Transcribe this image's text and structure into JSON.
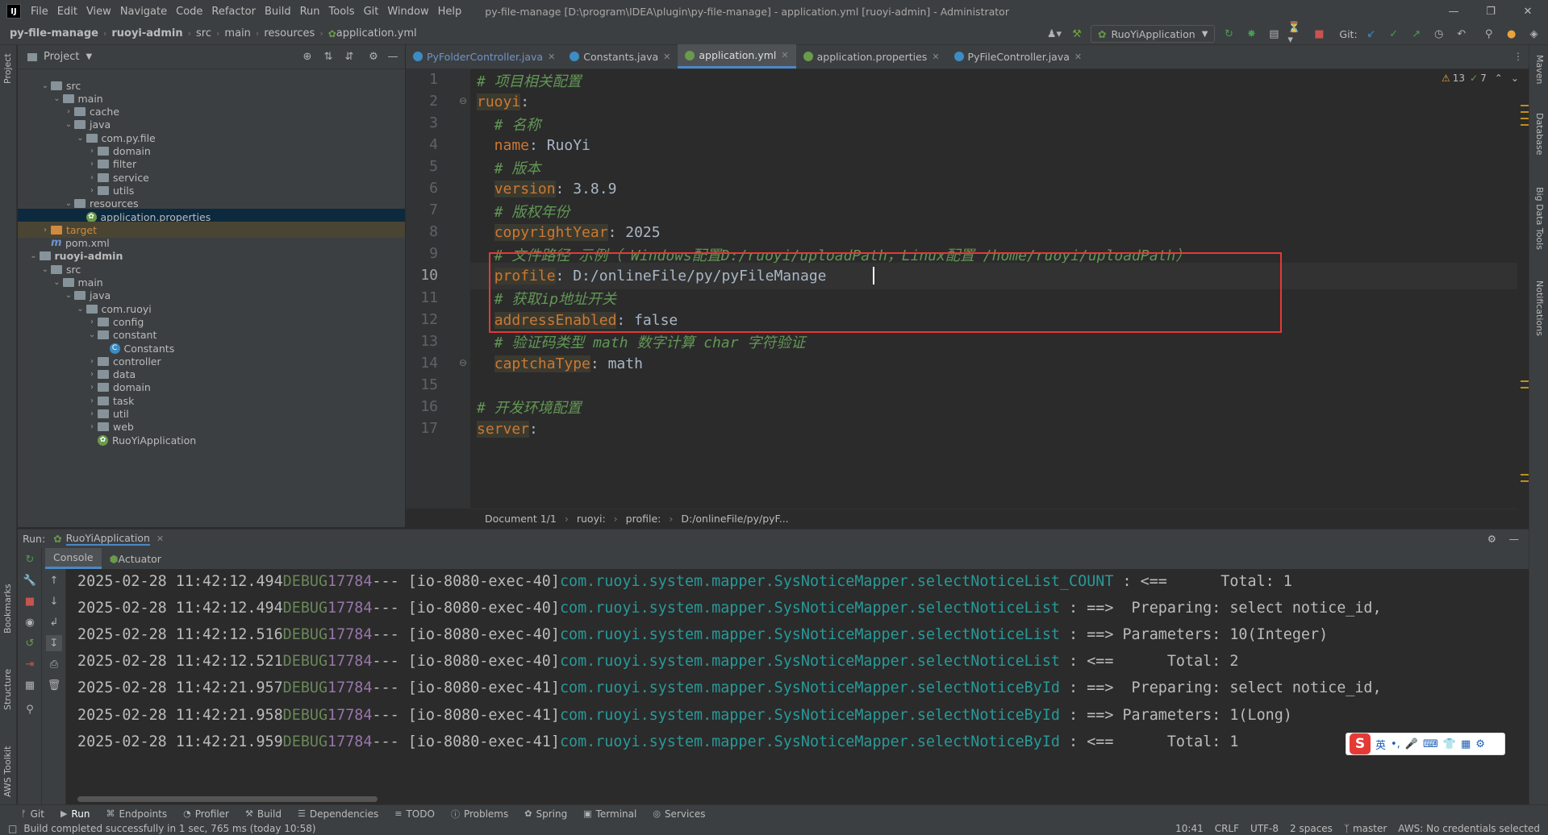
{
  "window": {
    "title": "py-file-manage [D:\\program\\IDEA\\plugin\\py-file-manage] - application.yml [ruoyi-admin] - Administrator",
    "menu": [
      "File",
      "Edit",
      "View",
      "Navigate",
      "Code",
      "Refactor",
      "Build",
      "Run",
      "Tools",
      "Git",
      "Window",
      "Help"
    ]
  },
  "breadcrumb": [
    "py-file-manage",
    "ruoyi-admin",
    "src",
    "main",
    "resources",
    "application.yml"
  ],
  "toolbar": {
    "run_config": "RuoYiApplication",
    "git_label": "Git:"
  },
  "left_stripe": {
    "project": "Project",
    "bookmarks": "Bookmarks",
    "structure": "Structure",
    "aws": "AWS Toolkit"
  },
  "right_stripe": {
    "maven": "Maven",
    "database": "Database",
    "bigdata": "Big Data Tools",
    "notifications": "Notifications"
  },
  "project_panel": {
    "header": "Project",
    "tree": [
      {
        "label": "src",
        "depth": 2,
        "type": "folder",
        "arrow": "open"
      },
      {
        "label": "main",
        "depth": 3,
        "type": "folder",
        "arrow": "open"
      },
      {
        "label": "cache",
        "depth": 4,
        "type": "folder",
        "arrow": "closed"
      },
      {
        "label": "java",
        "depth": 4,
        "type": "folder",
        "arrow": "open"
      },
      {
        "label": "com.py.file",
        "depth": 5,
        "type": "folder",
        "arrow": "open"
      },
      {
        "label": "domain",
        "depth": 6,
        "type": "folder",
        "arrow": "closed"
      },
      {
        "label": "filter",
        "depth": 6,
        "type": "folder",
        "arrow": "closed"
      },
      {
        "label": "service",
        "depth": 6,
        "type": "folder",
        "arrow": "closed"
      },
      {
        "label": "utils",
        "depth": 6,
        "type": "folder",
        "arrow": "closed"
      },
      {
        "label": "resources",
        "depth": 4,
        "type": "folder",
        "arrow": "open"
      },
      {
        "label": "application.properties",
        "depth": 5,
        "type": "leaf",
        "arrow": "",
        "selected": true
      },
      {
        "label": "target",
        "depth": 2,
        "type": "orange",
        "arrow": "closed"
      },
      {
        "label": "pom.xml",
        "depth": 2,
        "type": "m",
        "arrow": ""
      },
      {
        "label": "ruoyi-admin",
        "depth": 1,
        "type": "folder",
        "arrow": "open",
        "bold": true
      },
      {
        "label": "src",
        "depth": 2,
        "type": "folder",
        "arrow": "open"
      },
      {
        "label": "main",
        "depth": 3,
        "type": "folder",
        "arrow": "open"
      },
      {
        "label": "java",
        "depth": 4,
        "type": "folder",
        "arrow": "open"
      },
      {
        "label": "com.ruoyi",
        "depth": 5,
        "type": "folder",
        "arrow": "open"
      },
      {
        "label": "config",
        "depth": 6,
        "type": "folder",
        "arrow": "closed"
      },
      {
        "label": "constant",
        "depth": 6,
        "type": "folder",
        "arrow": "open"
      },
      {
        "label": "Constants",
        "depth": 7,
        "type": "cls",
        "arrow": ""
      },
      {
        "label": "controller",
        "depth": 6,
        "type": "folder",
        "arrow": "closed"
      },
      {
        "label": "data",
        "depth": 6,
        "type": "folder",
        "arrow": "closed"
      },
      {
        "label": "domain",
        "depth": 6,
        "type": "folder",
        "arrow": "closed"
      },
      {
        "label": "task",
        "depth": 6,
        "type": "folder",
        "arrow": "closed"
      },
      {
        "label": "util",
        "depth": 6,
        "type": "folder",
        "arrow": "closed"
      },
      {
        "label": "web",
        "depth": 6,
        "type": "folder",
        "arrow": "closed"
      },
      {
        "label": "RuoYiApplication",
        "depth": 6,
        "type": "leaf",
        "arrow": ""
      }
    ]
  },
  "editor": {
    "tabs": [
      {
        "label": "PyFolderController.java",
        "icon": "class-icon",
        "active": false
      },
      {
        "label": "Constants.java",
        "icon": "class-icon",
        "active": false
      },
      {
        "label": "application.yml",
        "icon": "spring-leaf-icon",
        "active": true
      },
      {
        "label": "application.properties",
        "icon": "spring-leaf-icon",
        "active": false
      },
      {
        "label": "PyFileController.java",
        "icon": "class-icon",
        "active": false
      }
    ],
    "inspections": {
      "warnings": "13",
      "weak": "7"
    },
    "lines": [
      {
        "n": "1",
        "segs": [
          {
            "t": "# 项目相关配置",
            "c": "cm"
          }
        ]
      },
      {
        "n": "2",
        "segs": [
          {
            "t": "ruoyi",
            "c": "key"
          },
          {
            "t": ":",
            "c": "val"
          }
        ]
      },
      {
        "n": "3",
        "segs": [
          {
            "t": "  # 名称",
            "c": "cm"
          }
        ]
      },
      {
        "n": "4",
        "segs": [
          {
            "t": "  name",
            "c": "keyp"
          },
          {
            "t": ": RuoYi",
            "c": "val"
          }
        ]
      },
      {
        "n": "5",
        "segs": [
          {
            "t": "  # 版本",
            "c": "cm"
          }
        ]
      },
      {
        "n": "6",
        "segs": [
          {
            "t": "  ",
            "c": "val"
          },
          {
            "t": "version",
            "c": "key"
          },
          {
            "t": ": 3.8.9",
            "c": "val"
          }
        ]
      },
      {
        "n": "7",
        "segs": [
          {
            "t": "  # 版权年份",
            "c": "cm"
          }
        ]
      },
      {
        "n": "8",
        "segs": [
          {
            "t": "  ",
            "c": "val"
          },
          {
            "t": "copyrightYear",
            "c": "key"
          },
          {
            "t": ": 2025",
            "c": "val"
          }
        ]
      },
      {
        "n": "9",
        "segs": [
          {
            "t": "  # 文件路径 示例（ Windows配置D:/ruoyi/uploadPath，Linux配置 /home/ruoyi/uploadPath）",
            "c": "cm"
          }
        ]
      },
      {
        "n": "10",
        "segs": [
          {
            "t": "  ",
            "c": "val"
          },
          {
            "t": "profile",
            "c": "key"
          },
          {
            "t": ": D:/onlineFile/py/pyFileManage",
            "c": "val"
          }
        ],
        "current": true
      },
      {
        "n": "11",
        "segs": [
          {
            "t": "  # 获取ip地址开关",
            "c": "cm"
          }
        ]
      },
      {
        "n": "12",
        "segs": [
          {
            "t": "  ",
            "c": "val"
          },
          {
            "t": "addressEnabled",
            "c": "key"
          },
          {
            "t": ": false",
            "c": "val"
          }
        ]
      },
      {
        "n": "13",
        "segs": [
          {
            "t": "  # 验证码类型 math 数字计算 char 字符验证",
            "c": "cm"
          }
        ]
      },
      {
        "n": "14",
        "segs": [
          {
            "t": "  ",
            "c": "val"
          },
          {
            "t": "captchaType",
            "c": "key"
          },
          {
            "t": ": math",
            "c": "val"
          }
        ]
      },
      {
        "n": "15",
        "segs": []
      },
      {
        "n": "16",
        "segs": [
          {
            "t": "# 开发环境配置",
            "c": "cm"
          }
        ]
      },
      {
        "n": "17",
        "segs": [
          {
            "t": "server",
            "c": "key"
          },
          {
            "t": ":",
            "c": "val"
          }
        ]
      }
    ],
    "crumbs": [
      "Document 1/1",
      "ruoyi:",
      "profile:",
      "D:/onlineFile/py/pyF..."
    ]
  },
  "run_panel": {
    "label": "Run:",
    "config": "RuoYiApplication",
    "subtabs": [
      "Console",
      "Actuator"
    ],
    "logs": [
      {
        "ts": "2025-02-28 11:42:12.494",
        "lvl": "DEBUG",
        "pid": "17784",
        "thr": "--- [io-8080-exec-40]",
        "logger": "com.ruoyi.system.mapper.SysNoticeMapper.selectNoticeList_COUNT",
        "msg": " : <==      Total: 1"
      },
      {
        "ts": "2025-02-28 11:42:12.494",
        "lvl": "DEBUG",
        "pid": "17784",
        "thr": "--- [io-8080-exec-40]",
        "logger": "com.ruoyi.system.mapper.SysNoticeMapper.selectNoticeList",
        "msg": " : ==>  Preparing: select notice_id,"
      },
      {
        "ts": "2025-02-28 11:42:12.516",
        "lvl": "DEBUG",
        "pid": "17784",
        "thr": "--- [io-8080-exec-40]",
        "logger": "com.ruoyi.system.mapper.SysNoticeMapper.selectNoticeList",
        "msg": " : ==> Parameters: 10(Integer)"
      },
      {
        "ts": "2025-02-28 11:42:12.521",
        "lvl": "DEBUG",
        "pid": "17784",
        "thr": "--- [io-8080-exec-40]",
        "logger": "com.ruoyi.system.mapper.SysNoticeMapper.selectNoticeList",
        "msg": " : <==      Total: 2"
      },
      {
        "ts": "2025-02-28 11:42:21.957",
        "lvl": "DEBUG",
        "pid": "17784",
        "thr": "--- [io-8080-exec-41]",
        "logger": "com.ruoyi.system.mapper.SysNoticeMapper.selectNoticeById",
        "msg": " : ==>  Preparing: select notice_id,"
      },
      {
        "ts": "2025-02-28 11:42:21.958",
        "lvl": "DEBUG",
        "pid": "17784",
        "thr": "--- [io-8080-exec-41]",
        "logger": "com.ruoyi.system.mapper.SysNoticeMapper.selectNoticeById",
        "msg": " : ==> Parameters: 1(Long)"
      },
      {
        "ts": "2025-02-28 11:42:21.959",
        "lvl": "DEBUG",
        "pid": "17784",
        "thr": "--- [io-8080-exec-41]",
        "logger": "com.ruoyi.system.mapper.SysNoticeMapper.selectNoticeById",
        "msg": " : <==      Total: 1"
      }
    ]
  },
  "ime": {
    "lang": "英"
  },
  "bottom_tools": [
    {
      "label": "Git",
      "icon": "git-icon"
    },
    {
      "label": "Run",
      "icon": "run-icon",
      "active": true
    },
    {
      "label": "Endpoints",
      "icon": "endpoints-icon"
    },
    {
      "label": "Profiler",
      "icon": "profiler-icon"
    },
    {
      "label": "Build",
      "icon": "build-icon"
    },
    {
      "label": "Dependencies",
      "icon": "dependencies-icon"
    },
    {
      "label": "TODO",
      "icon": "todo-icon"
    },
    {
      "label": "Problems",
      "icon": "problems-icon"
    },
    {
      "label": "Spring",
      "icon": "spring-icon"
    },
    {
      "label": "Terminal",
      "icon": "terminal-icon"
    },
    {
      "label": "Services",
      "icon": "services-icon"
    }
  ],
  "status": {
    "message": "Build completed successfully in 1 sec, 765 ms (today 10:58)",
    "position": "10:41",
    "line_sep": "CRLF",
    "encoding": "UTF-8",
    "indent": "2 spaces",
    "branch": "master",
    "aws": "AWS: No credentials selected"
  },
  "colors": {
    "accent": "#4a88c7",
    "highlight_box": "#e53935",
    "comment": "#629755",
    "key": "#cc7832"
  }
}
